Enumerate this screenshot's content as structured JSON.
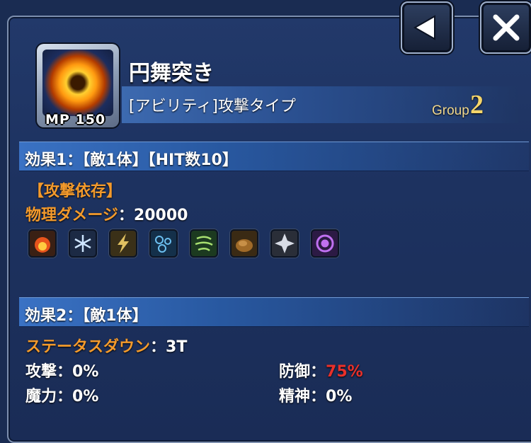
{
  "skill": {
    "name": "円舞突き",
    "mp_label": "MP",
    "mp_value": "150",
    "type": "[アビリティ]攻撃タイプ",
    "group_label": "Group",
    "group_number": "2"
  },
  "effect1": {
    "header": "効果1：【敵1体】【HIT数10】",
    "dependency": "【攻撃依存】",
    "damage_label": "物理ダメージ",
    "damage_sep": "：",
    "damage_value": "20000",
    "element_icons": [
      "fire-icon",
      "ice-icon",
      "thunder-icon",
      "water-icon",
      "wind-icon",
      "earth-icon",
      "light-icon",
      "dark-icon"
    ]
  },
  "effect2": {
    "header": "効果2：【敵1体】",
    "status_label": "ステータスダウン",
    "status_sep": "：",
    "status_value": "3T",
    "attack_label": "攻撃",
    "attack_value": "：0%",
    "defense_label": "防御",
    "defense_sep": "：",
    "defense_value": "75%",
    "magic_label": "魔力",
    "magic_value": "：0%",
    "spirit_label": "精神",
    "spirit_value": "：0%"
  },
  "colors": {
    "accent_orange": "#f39a2c",
    "highlight_red": "#e8302a",
    "header_blue": "#3a72c4"
  }
}
